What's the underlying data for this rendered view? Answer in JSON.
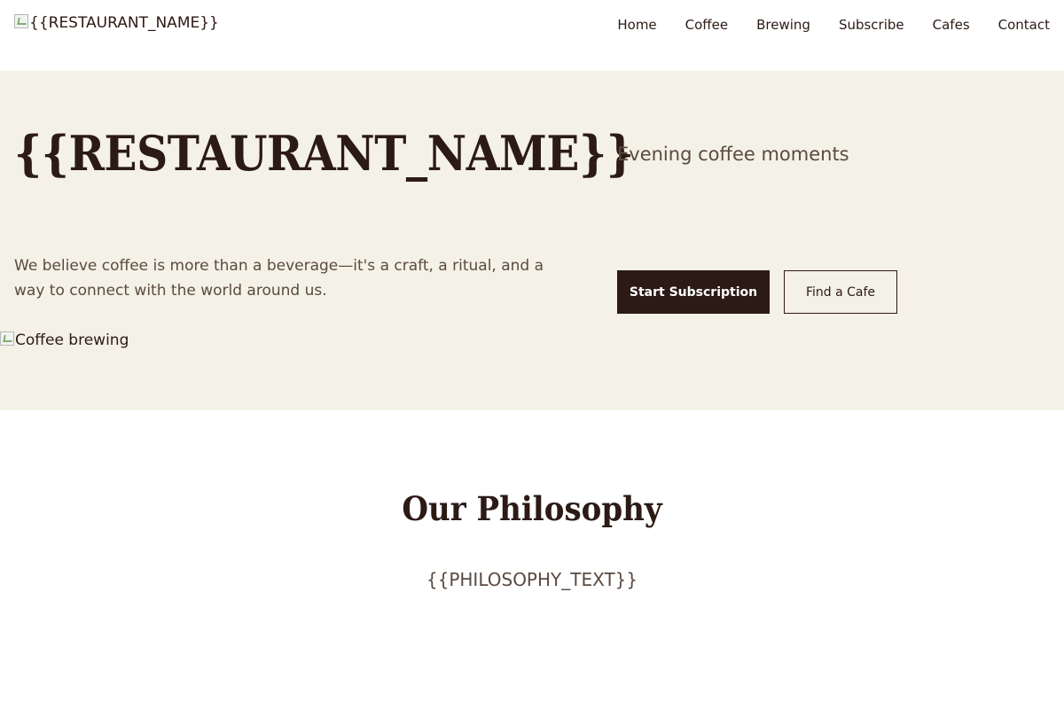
{
  "header": {
    "logo_alt": "{{RESTAURANT_NAME}}",
    "nav": {
      "home": "Home",
      "coffee": "Coffee",
      "brewing": "Brewing",
      "subscribe": "Subscribe",
      "cafes": "Cafes",
      "contact": "Contact"
    }
  },
  "hero": {
    "title": "{{RESTAURANT_NAME}}",
    "tagline": "Evening coffee moments",
    "description": "We believe coffee is more than a beverage—it's a craft, a ritual, and a way to connect with the world around us.",
    "primary_button": "Start Subscription",
    "secondary_button": "Find a Cafe",
    "image_alt": "Coffee brewing"
  },
  "philosophy": {
    "title": "Our Philosophy",
    "text": "{{PHILOSOPHY_TEXT}}"
  },
  "colors": {
    "brand_dark": "#2c1a14",
    "hero_background": "#f4f1e6",
    "muted_text": "#5a4a42"
  }
}
